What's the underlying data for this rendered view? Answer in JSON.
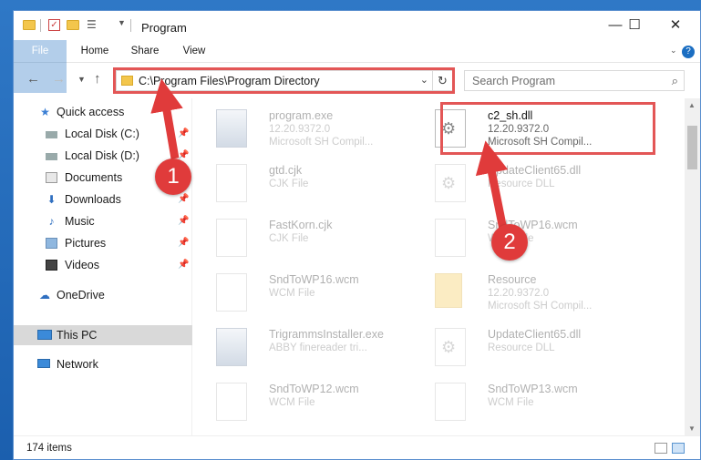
{
  "window": {
    "title": "Program"
  },
  "tabs": [
    {
      "label": "File"
    },
    {
      "label": "Home"
    },
    {
      "label": "Share"
    },
    {
      "label": "View"
    }
  ],
  "address": {
    "path": "C:\\Program Files\\Program Directory"
  },
  "search": {
    "placeholder": "Search Program"
  },
  "sidebar": {
    "items": [
      {
        "label": "Quick access",
        "icon": "star-icon"
      },
      {
        "label": "Local Disk (C:)",
        "icon": "drive-icon"
      },
      {
        "label": "Local Disk (D:)",
        "icon": "drive-icon"
      },
      {
        "label": "Documents",
        "icon": "documents-icon"
      },
      {
        "label": "Downloads",
        "icon": "download-icon"
      },
      {
        "label": "Music",
        "icon": "music-icon"
      },
      {
        "label": "Pictures",
        "icon": "pictures-icon"
      },
      {
        "label": "Videos",
        "icon": "videos-icon"
      },
      {
        "label": "OneDrive",
        "icon": "cloud-icon"
      },
      {
        "label": "This PC",
        "icon": "computer-icon"
      },
      {
        "label": "Network",
        "icon": "network-icon"
      }
    ]
  },
  "files": [
    {
      "name": "program.exe",
      "line1": "12.20.9372.0",
      "line2": "Microsoft SH Compil...",
      "kind": "exe"
    },
    {
      "name": "c2_sh.dll",
      "line1": "12.20.9372.0",
      "line2": "Microsoft SH Compil...",
      "kind": "dll"
    },
    {
      "name": "gtd.cjk",
      "line1": "CJK File",
      "line2": "",
      "kind": "file"
    },
    {
      "name": "UpdateClient65.dll",
      "line1": "Resource DLL",
      "line2": "",
      "kind": "dll"
    },
    {
      "name": "FastKorn.cjk",
      "line1": "CJK File",
      "line2": "",
      "kind": "file"
    },
    {
      "name": "SndToWP16.wcm",
      "line1": "WCM File",
      "line2": "",
      "kind": "file"
    },
    {
      "name": "SndToWP16.wcm",
      "line1": "WCM File",
      "line2": "",
      "kind": "file"
    },
    {
      "name": "Resource",
      "line1": "12.20.9372.0",
      "line2": "Microsoft SH Compil...",
      "kind": "folder"
    },
    {
      "name": "TrigrammsInstaller.exe",
      "line1": "ABBY finereader tri...",
      "line2": "",
      "kind": "exe"
    },
    {
      "name": "UpdateClient65.dll",
      "line1": "Resource DLL",
      "line2": "",
      "kind": "dll"
    },
    {
      "name": "SndToWP12.wcm",
      "line1": "WCM File",
      "line2": "",
      "kind": "file"
    },
    {
      "name": "SndToWP13.wcm",
      "line1": "WCM File",
      "line2": "",
      "kind": "file"
    }
  ],
  "status": {
    "items_count": "174 items"
  },
  "annotations": [
    {
      "label": "1"
    },
    {
      "label": "2"
    }
  ],
  "colors": {
    "accent": "#1b6ec2",
    "highlight": "#e35656",
    "badge": "#e03b3b"
  }
}
